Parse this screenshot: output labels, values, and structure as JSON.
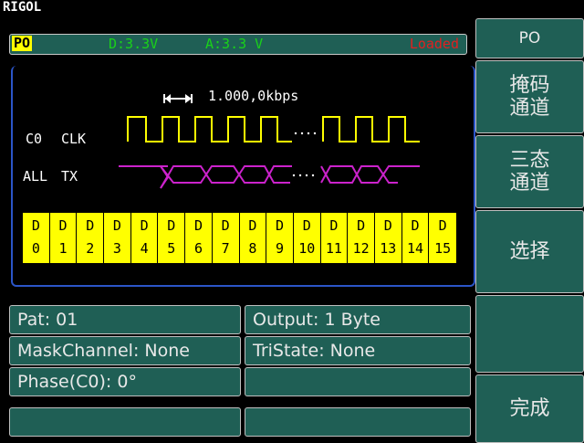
{
  "brand": "RIGOL",
  "status": {
    "pattern": "PO",
    "digital_level": "D:3.3V",
    "analog_level": "A:3.3 V",
    "state": "Loaded"
  },
  "waveform": {
    "rate": "1.000,0kbps",
    "signals": [
      {
        "channel": "C0",
        "name": "CLK"
      },
      {
        "channel": "ALL",
        "name": "TX"
      }
    ],
    "ellipsis": "....",
    "channels": [
      "0",
      "1",
      "2",
      "3",
      "4",
      "5",
      "6",
      "7",
      "8",
      "9",
      "10",
      "11",
      "12",
      "13",
      "14",
      "15"
    ],
    "channel_prefix": "D"
  },
  "fields": {
    "pat": "Pat:  01",
    "output": "Output: 1  Byte",
    "mask_channel": "MaskChannel: None",
    "tristate": "TriState:  None",
    "phase": "Phase(C0):  0°"
  },
  "softkeys": {
    "po": "PO",
    "mask_line1": "掩码",
    "mask_line2": "通道",
    "tri_line1": "三态",
    "tri_line2": "通道",
    "select": "选择",
    "done": "完成"
  },
  "colors": {
    "panel": "#1f5f55",
    "highlight": "#ffff00",
    "clk": "#ffff00",
    "tx": "#cc22cc",
    "loaded": "#e02020",
    "level": "#19d219",
    "frame": "#2b55c8"
  }
}
